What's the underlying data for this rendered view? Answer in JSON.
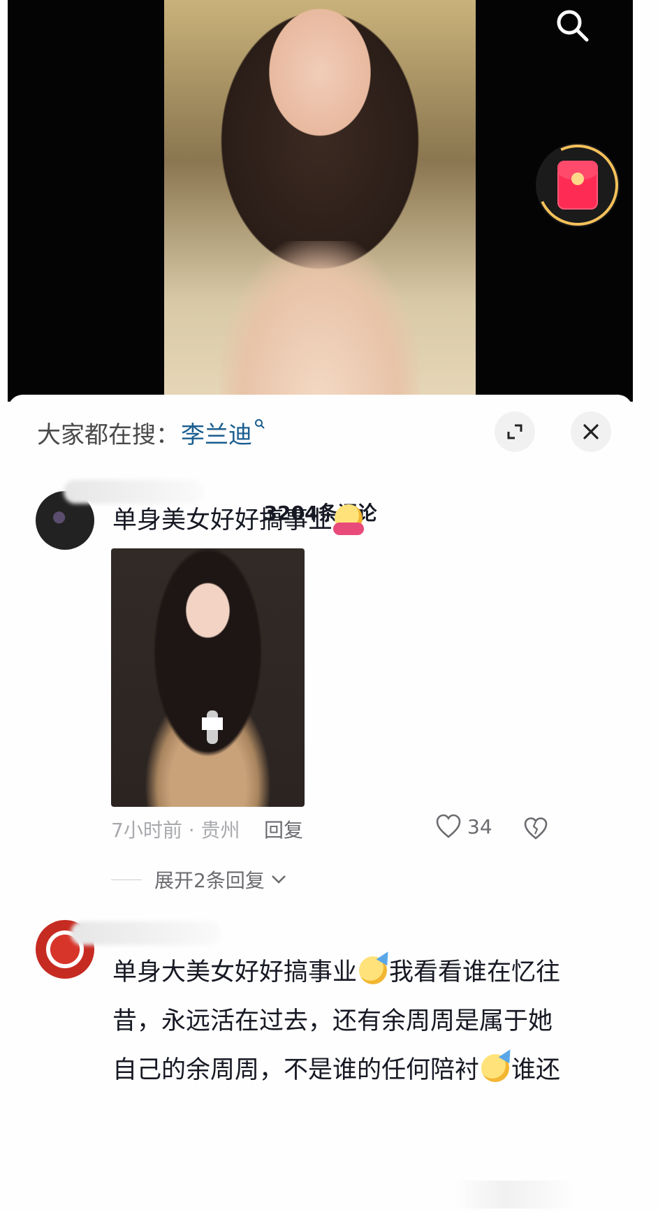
{
  "hot_search": {
    "label": "大家都在搜：",
    "keyword": "李兰迪"
  },
  "comments_count": "3204条评论",
  "comments": [
    {
      "text": "单身美女好好搞事业",
      "emoji": "smiling-face-with-hearts-hug",
      "meta": "7小时前 · 贵州",
      "reply_label": "回复",
      "likes": "34",
      "expand_label": "展开2条回复"
    },
    {
      "lines": [
        "单身大美女好好搞事业",
        "我看看谁在忆往",
        "昔，永远活在过去，还有余周周是属于她",
        "自己的余周周，不是谁的任何陪衬",
        "谁还"
      ],
      "emoji": "party-face"
    }
  ],
  "colors": {
    "accent_blue": "#1a5d8f",
    "red_packet": "#fe2c55",
    "ring": "#f5c15a"
  }
}
